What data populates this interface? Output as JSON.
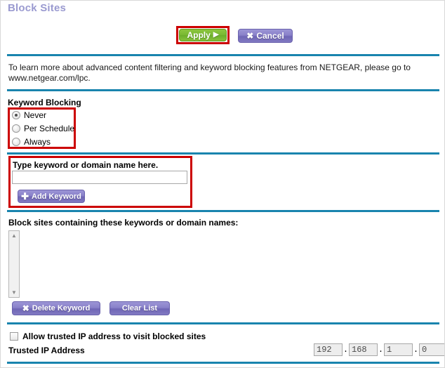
{
  "page": {
    "title": "Block Sites",
    "accent_divider_color": "#1984ae",
    "highlight_color": "#cc0000",
    "title_color": "#9a9ad0"
  },
  "toolbar": {
    "apply_label": "Apply",
    "apply_glyph": "▶",
    "cancel_label": "Cancel",
    "cancel_glyph": "✖"
  },
  "info": {
    "text": "To learn more about advanced content filtering and keyword blocking features from NETGEAR, please go to www.netgear.com/lpc."
  },
  "keyword_blocking": {
    "label": "Keyword Blocking",
    "options": [
      {
        "label": "Never",
        "selected": true
      },
      {
        "label": "Per Schedule",
        "selected": false
      },
      {
        "label": "Always",
        "selected": false
      }
    ]
  },
  "add_keyword": {
    "label": "Type keyword or domain name here.",
    "input_value": "",
    "input_placeholder": "",
    "button_label": "Add Keyword",
    "button_glyph": "✚"
  },
  "block_list": {
    "label": "Block sites containing these keywords or domain names:",
    "items": [],
    "scroll_up_glyph": "▲",
    "scroll_down_glyph": "▼",
    "delete_label": "Delete Keyword",
    "delete_glyph": "✖",
    "clear_label": "Clear List"
  },
  "trusted_ip": {
    "checkbox_label": "Allow trusted IP address to visit blocked sites",
    "checkbox_checked": false,
    "address_label": "Trusted IP Address",
    "octets": [
      "192",
      "168",
      "1",
      "0"
    ],
    "separator": "."
  }
}
